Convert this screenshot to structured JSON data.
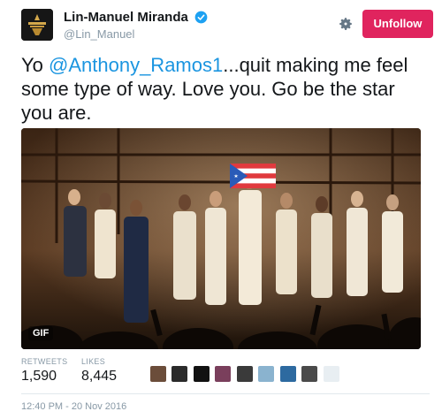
{
  "user": {
    "display_name": "Lin-Manuel Miranda",
    "handle": "@Lin_Manuel",
    "verified": true
  },
  "actions": {
    "gear_icon": "gear-icon",
    "follow_button_label": "Unfollow"
  },
  "tweet": {
    "text_prefix": "Yo ",
    "mention": "@Anthony_Ramos1",
    "text_suffix": "...quit making me feel some type of way. Love you. Go be the star you are."
  },
  "media": {
    "badge": "GIF"
  },
  "stats": {
    "retweets_label": "RETWEETS",
    "retweets_value": "1,590",
    "likes_label": "LIKES",
    "likes_value": "8,445",
    "liker_count": 9
  },
  "timestamp": "12:40 PM - 20 Nov 2016",
  "colors": {
    "accent_link": "#1b95e0",
    "follow_button": "#e0245e",
    "muted_text": "#8899a6",
    "verified_badge": "#1da1f2"
  }
}
